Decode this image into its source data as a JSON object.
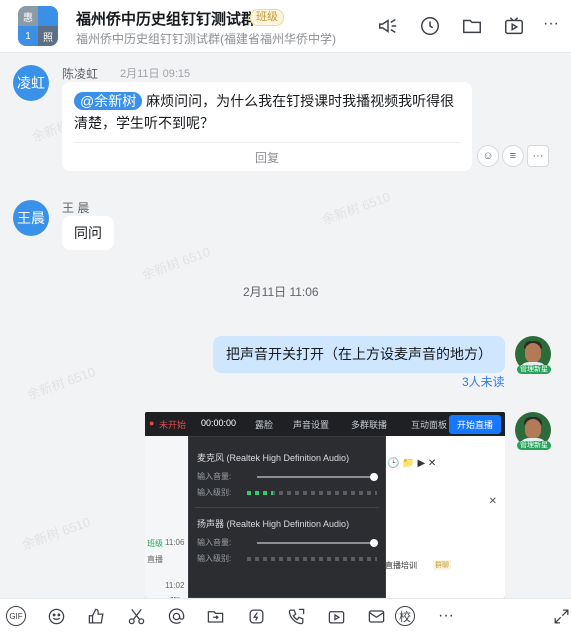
{
  "header": {
    "avatar_chars": [
      "惠",
      "",
      "1",
      "照"
    ],
    "title": "福州侨中历史组钉钉测试群",
    "badge": "班级",
    "subtitle": "福州侨中历史组钉钉测试群(福建省福州华侨中学)",
    "icons": [
      "megaphone-icon",
      "clock-icon",
      "folder-icon",
      "video-icon",
      "more-icon"
    ]
  },
  "watermark": "余新树 6510",
  "messages": [
    {
      "avatar": "凌虹",
      "sender": "陈凌虹",
      "time": "2月11日 09:15",
      "mention": "@余新树",
      "text_line1": "麻烦问问，为什么我在钉授课时我播视频我听得很",
      "text_line2": "清楚，学生听不到呢？",
      "reply": "回复",
      "more": "···"
    },
    {
      "avatar": "王晨",
      "sender": "王 晨",
      "text": "同问"
    }
  ],
  "timestamp": "2月11日 11:06",
  "my_messages": [
    {
      "text": "把声音开关打开（在上方设麦声音的地方）",
      "unread": "3人未读",
      "tag": "管理新星"
    }
  ],
  "screenshot": {
    "status": "未开始",
    "timer": "00:00:00",
    "menu": [
      "露脸",
      "声音设置",
      "多群联播",
      "互动面板"
    ],
    "live_button": "开始直播",
    "mic_label": "麦克风 (Realtek High Definition Audio)",
    "speaker_label": "扬声器 (Realtek High Definition Audio)",
    "input_volume": "输入音量:",
    "input_level": "输入级别:",
    "left_items": [
      "班级",
      "11:06",
      "直播",
      "11:02",
      "频道",
      "48"
    ],
    "right_items": [
      "直播培训",
      "群聊"
    ]
  },
  "toolbar": [
    "gif-icon",
    "emoji-icon",
    "thumbs-up-icon",
    "scissors-icon",
    "at-icon",
    "folder-send-icon",
    "flash-icon",
    "phone-icon",
    "video-play-icon",
    "mail-icon",
    "school-icon",
    "more-icon",
    "expand-icon"
  ]
}
